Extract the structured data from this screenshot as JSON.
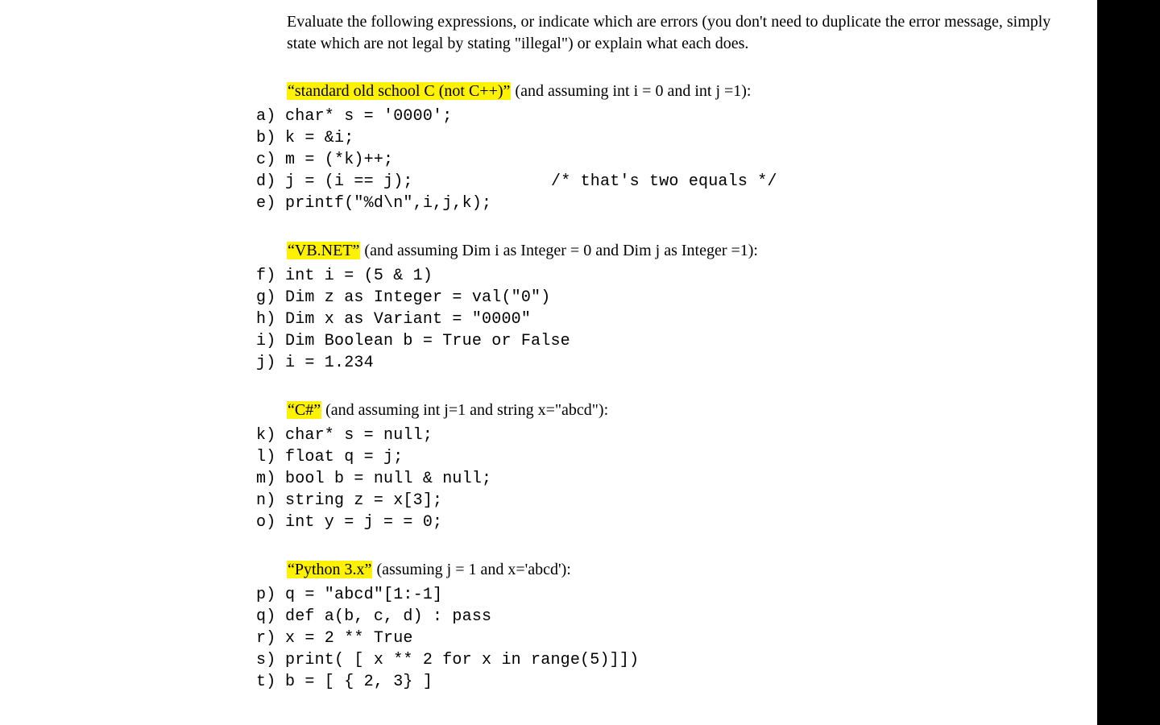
{
  "instructions": {
    "pre": "Evaluate the following expressions, or indicate which are errors (you don't need to duplicate the error message, simply state which are not legal by stating \"illegal\") or ",
    "explain": "explain",
    "post": " what each does."
  },
  "sections": [
    {
      "title": "“standard old school C (not C++)”",
      "header_rest": " (and assuming int i = 0 and int j =1):",
      "items": [
        {
          "label": "a)",
          "code": "char* s = '0000';",
          "comment": ""
        },
        {
          "label": "b)",
          "code": "k = &i;",
          "comment": ""
        },
        {
          "label": "c)",
          "code": "m = (*k)++;",
          "comment": ""
        },
        {
          "label": "d)",
          "code": "j = (i == j);",
          "comment": "/* that's two equals */"
        },
        {
          "label": "e)",
          "code": "printf(\"%d\\n\",i,j,k);",
          "comment": ""
        }
      ]
    },
    {
      "title": "“VB.NET”",
      "header_rest": " (and assuming Dim i as Integer = 0 and Dim j as Integer =1):",
      "items": [
        {
          "label": "f)",
          "code": "int i = (5 & 1)",
          "comment": ""
        },
        {
          "label": "g)",
          "code": "Dim z as Integer = val(\"0\")",
          "comment": ""
        },
        {
          "label": "h)",
          "code": "Dim x as Variant = \"0000\"",
          "comment": ""
        },
        {
          "label": "i)",
          "code": "Dim Boolean b = True or False",
          "comment": ""
        },
        {
          "label": "j)",
          "code": "i = 1.234",
          "comment": ""
        }
      ]
    },
    {
      "title": "“C#”",
      "header_rest": " (and assuming int j=1 and string x=\"abcd\"):",
      "items": [
        {
          "label": "k)",
          "code": "char* s = null;",
          "comment": ""
        },
        {
          "label": "l)",
          "code": "float q = j;",
          "comment": ""
        },
        {
          "label": "m)",
          "code": "bool b = null & null;",
          "comment": ""
        },
        {
          "label": "n)",
          "code": "string z = x[3];",
          "comment": ""
        },
        {
          "label": "o)",
          "code": "int y = j = = 0;",
          "comment": ""
        }
      ]
    },
    {
      "title": "“Python 3.x”",
      "header_rest": " (assuming j = 1 and x='abcd'):",
      "items": [
        {
          "label": "p)",
          "code": "q = \"abcd\"[1:-1]",
          "comment": ""
        },
        {
          "label": "q)",
          "code": "def a(b, c, d) : pass",
          "comment": ""
        },
        {
          "label": "r)",
          "code": "x = 2 ** True",
          "comment": ""
        },
        {
          "label": "s)",
          "code": "print( [ x ** 2 for x in range(5)]])",
          "comment": ""
        },
        {
          "label": "t)",
          "code": "b = [ { 2, 3} ]",
          "comment": ""
        }
      ]
    }
  ]
}
